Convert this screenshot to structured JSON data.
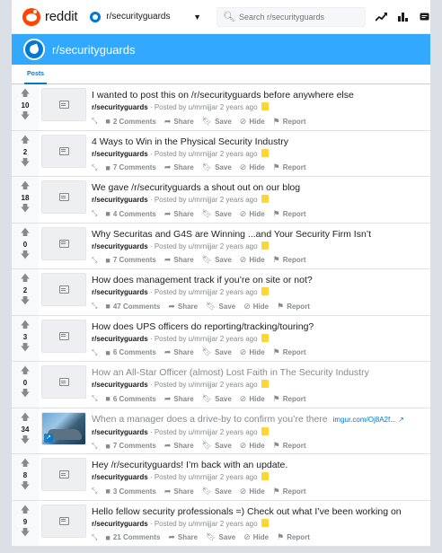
{
  "header": {
    "logo_text": "reddit",
    "community": "r/securityguards",
    "search_placeholder": "Search r/securityguards"
  },
  "banner": {
    "title": "r/securityguards"
  },
  "tabs": [
    {
      "label": "Posts"
    }
  ],
  "actions": {
    "share": "Share",
    "save": "Save",
    "hide": "Hide",
    "report": "Report"
  },
  "posts": [
    {
      "score": "10",
      "title": "I wanted to post this on /r/securityguards before anywhere else",
      "subreddit": "r/securityguards",
      "meta": "· Posted by u/mrnijjar 2 years ago",
      "comments": "2 Comments",
      "visited": false,
      "thumbnail": "text"
    },
    {
      "score": "2",
      "title": "4 Ways to Win in the Physical Security Industry",
      "subreddit": "r/securityguards",
      "meta": "· Posted by u/mrnijjar 2 years ago",
      "comments": "7 Comments",
      "visited": false,
      "thumbnail": "text"
    },
    {
      "score": "18",
      "title": "We gave /r/securityguards a shout out on our blog",
      "subreddit": "r/securityguards",
      "meta": "· Posted by u/mrnijjar 2 years ago",
      "comments": "4 Comments",
      "visited": false,
      "thumbnail": "text"
    },
    {
      "score": "0",
      "title": "Why Securitas and G4S are Winning ...and Your Security Firm Isn’t",
      "subreddit": "r/securityguards",
      "meta": "· Posted by u/mrnijjar 2 years ago",
      "comments": "7 Comments",
      "visited": false,
      "thumbnail": "text"
    },
    {
      "score": "2",
      "title": "How does management track if you’re on site or not?",
      "subreddit": "r/securityguards",
      "meta": "· Posted by u/mrnijjar 2 years ago",
      "comments": "47 Comments",
      "visited": false,
      "thumbnail": "text"
    },
    {
      "score": "3",
      "title": "How does UPS officers do reporting/tracking/touring?",
      "subreddit": "r/securityguards",
      "meta": "· Posted by u/mrnijjar 2 years ago",
      "comments": "6 Comments",
      "visited": false,
      "thumbnail": "text"
    },
    {
      "score": "0",
      "title": "How an All-Star Officer (almost) Lost Faith in The Security Industry",
      "subreddit": "r/securityguards",
      "meta": "· Posted by u/mrnijjar 2 years ago",
      "comments": "6 Comments",
      "visited": true,
      "thumbnail": "text"
    },
    {
      "score": "34",
      "title": "When a manager does a drive-by to confirm you’re there",
      "domain": "imgur.com/Oj8A2f... ↗",
      "subreddit": "r/securityguards",
      "meta": "· Posted by u/mrnijjar 2 years ago",
      "comments": "7 Comments",
      "visited": true,
      "thumbnail": "image"
    },
    {
      "score": "8",
      "title": "Hey /r/securityguards! I’m back with an update.",
      "subreddit": "r/securityguards",
      "meta": "· Posted by u/mrnijjar 2 years ago",
      "comments": "3 Comments",
      "visited": false,
      "thumbnail": "text"
    },
    {
      "score": "9",
      "title": "Hello fellow security professionals =) Check out what I’ve been working on",
      "subreddit": "r/securityguards",
      "meta": "· Posted by u/mrnijjar 2 years ago",
      "comments": "21 Comments",
      "visited": false,
      "thumbnail": "text"
    }
  ]
}
